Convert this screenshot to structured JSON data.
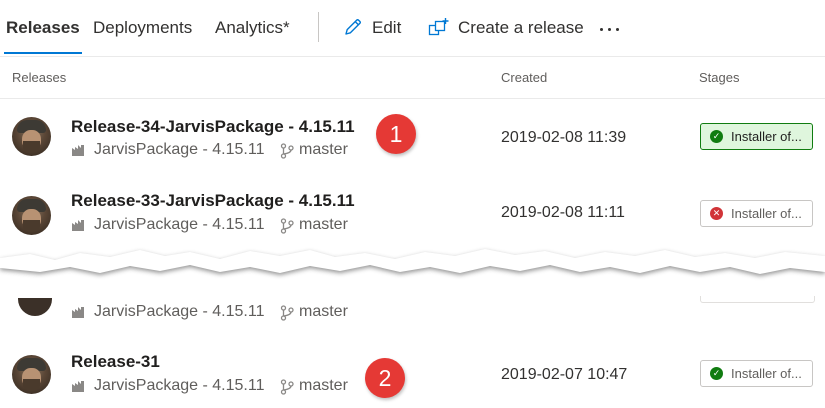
{
  "toolbar": {
    "tabs": [
      "Releases",
      "Deployments",
      "Analytics*"
    ],
    "active_tab": "Releases",
    "edit_label": "Edit",
    "create_label": "Create a release",
    "more_icon": "more-horizontal-icon",
    "edit_icon": "pencil-icon",
    "create_icon": "create-release-icon",
    "accent_color": "#0078d4"
  },
  "columns": {
    "releases": "Releases",
    "created": "Created",
    "stages": "Stages"
  },
  "rows": [
    {
      "title": "Release-34-JarvisPackage - 4.15.11",
      "package": "JarvisPackage - 4.15.11",
      "branch": "master",
      "created": "2019-02-08 11:39",
      "stage": "Installer of...",
      "stage_status": "succeeded",
      "callout": "1"
    },
    {
      "title": "Release-33-JarvisPackage - 4.15.11",
      "package": "JarvisPackage - 4.15.11",
      "branch": "master",
      "created": "2019-02-08 11:11",
      "stage": "Installer of...",
      "stage_status": "failed"
    },
    {
      "title": "",
      "package": "JarvisPackage - 4.15.11",
      "branch": "master",
      "created": "",
      "stage": "",
      "stage_status": "partially-visible"
    },
    {
      "title": "Release-31",
      "package": "JarvisPackage - 4.15.11",
      "branch": "master",
      "created": "2019-02-07 10:47",
      "stage": "Installer of...",
      "stage_status": "succeeded",
      "callout": "2"
    }
  ],
  "colors": {
    "success": "#107c10",
    "success_bg": "#dff6dd",
    "failure": "#d13438",
    "callout": "#e53935"
  }
}
